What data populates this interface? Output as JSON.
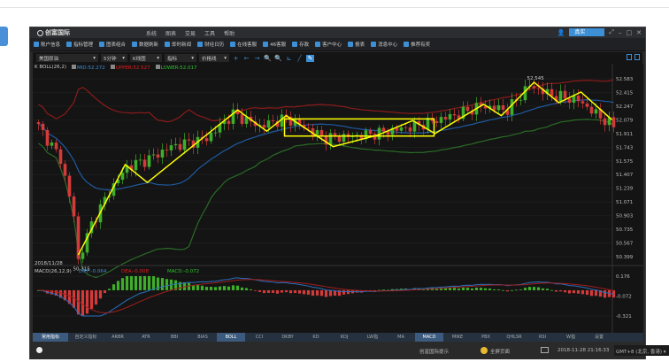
{
  "app": {
    "title": "创富国际",
    "menu": [
      "系统",
      "图表",
      "交易",
      "工具",
      "帮助"
    ],
    "account_mode": "真实"
  },
  "toolbar": [
    "账户信息",
    "指标管理",
    "图表组合",
    "数据刷新",
    "即时新闻",
    "财经日历",
    "在线客服",
    "46客服",
    "存款",
    "客户中心",
    "报表",
    "消息中心",
    "推荐有奖"
  ],
  "selectors": {
    "symbol": "美国原油",
    "period": "5分钟",
    "chart_type": "K线图",
    "indicator": "指标",
    "price_line": "价格线"
  },
  "main_legend": {
    "prefix": "K  BOLL(26,2)",
    "mid": "MID:52.272",
    "upper": "UPPER:52.527",
    "lower": "LOWER:52.017"
  },
  "macd_legend": {
    "date": "2018/11/28",
    "prefix": "MACD(26,12,9)",
    "diff": "DIFF:-0.064",
    "dea": "DEA:-0.008",
    "macd": "MACD:-0.072"
  },
  "colors": {
    "up": "#d43a3a",
    "down": "#3fae2a",
    "mid": "#1f5aa0",
    "upper": "#8b1b1b",
    "lower": "#2a6b25",
    "pattern": "#ffff00",
    "accent": "#3d8fd6"
  },
  "chart_data": {
    "type": "candlestick",
    "price_ticks": [
      "52.583",
      "52.415",
      "52.247",
      "52.079",
      "51.911",
      "51.743",
      "51.575",
      "51.407",
      "51.239",
      "51.071",
      "50.903",
      "50.735",
      "50.567",
      "50.399"
    ],
    "ylim": [
      50.399,
      52.583
    ],
    "bars": 131,
    "path": [
      [
        0,
        52.0
      ],
      [
        5,
        51.6
      ],
      [
        8,
        50.9
      ],
      [
        9,
        50.35
      ],
      [
        12,
        50.8
      ],
      [
        16,
        51.2
      ],
      [
        20,
        51.5
      ],
      [
        25,
        51.6
      ],
      [
        30,
        51.75
      ],
      [
        38,
        51.85
      ],
      [
        44,
        52.15
      ],
      [
        50,
        52.0
      ],
      [
        56,
        52.1
      ],
      [
        65,
        51.85
      ],
      [
        75,
        51.9
      ],
      [
        85,
        52.0
      ],
      [
        95,
        52.15
      ],
      [
        100,
        52.25
      ],
      [
        106,
        52.2
      ],
      [
        111,
        52.5
      ],
      [
        116,
        52.38
      ],
      [
        122,
        52.32
      ],
      [
        126,
        52.15
      ],
      [
        130,
        52.0
      ]
    ],
    "high_label": "52.545",
    "low_label": "50.315",
    "pattern": [
      [
        9,
        50.42
      ],
      [
        19.6,
        51.53
      ],
      [
        24.6,
        51.31
      ],
      [
        45,
        52.2
      ],
      [
        51.6,
        51.94
      ],
      [
        56,
        52.13
      ],
      [
        66.6,
        51.75
      ],
      [
        76.6,
        51.89
      ],
      [
        84.6,
        52.07
      ],
      [
        89.6,
        51.91
      ],
      [
        100.6,
        52.27
      ],
      [
        104.6,
        52.13
      ],
      [
        112,
        52.54
      ],
      [
        117.6,
        52.29
      ],
      [
        122.6,
        52.42
      ],
      [
        129.6,
        52.08
      ]
    ],
    "rectangle": {
      "from": 55.6,
      "to": 89.4,
      "top": 52.09,
      "bottom": 51.88
    },
    "macd_ticks": [
      "0.176",
      "-0.072",
      "-0.321"
    ],
    "macd_ylim": [
      -0.321,
      0.176
    ]
  },
  "tabs": [
    "常用指标",
    "自定义指标",
    "ARBR",
    "ATR",
    "BBI",
    "BIAS",
    "BOLL",
    "CCI",
    "DKBY",
    "KD",
    "KDJ",
    "LW指",
    "MA",
    "MACD",
    "MIKE",
    "PBX",
    "QHLSR",
    "RSI",
    "W指",
    "设置"
  ],
  "status": {
    "notice": "创富国际提示",
    "fullscreen": "全屏页面",
    "datetime": "2018-11-28 21:16:33",
    "timezone": "GMT+8 (北京, 香港)"
  }
}
